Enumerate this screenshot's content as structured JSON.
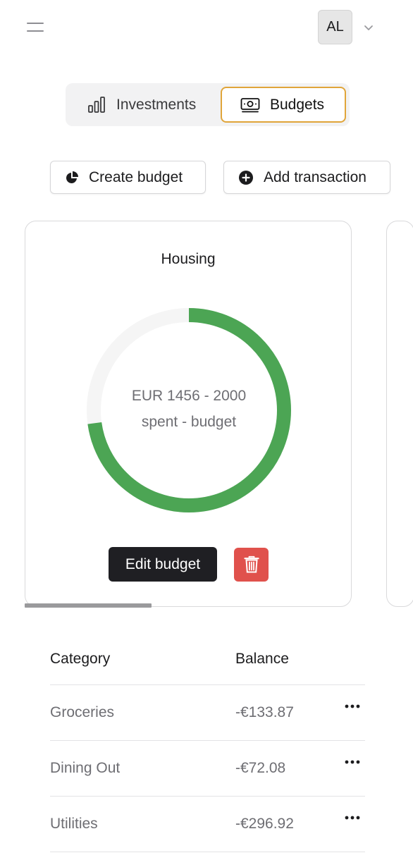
{
  "header": {
    "avatar_initials": "AL",
    "menu_icon": "hamburger-icon",
    "avatar_caret_icon": "chevron-down-icon"
  },
  "tabs": [
    {
      "label": "Investments",
      "icon": "bar-chart-icon",
      "selected": false
    },
    {
      "label": "Budgets",
      "icon": "cash-icon",
      "selected": true
    }
  ],
  "actions": {
    "create_budget": "Create budget",
    "add_transaction": "Add transaction"
  },
  "budget_card": {
    "title": "Housing",
    "line1": "EUR 1456 - 2000",
    "line2": "spent - budget",
    "spent": 1456,
    "budget": 2000,
    "edit_label": "Edit budget",
    "delete_icon": "trash-icon",
    "ring_color": "#4ca554",
    "ring_track_color": "#f5f5f5"
  },
  "carousel": {
    "scroll_fraction_visible": 0.39
  },
  "table": {
    "headers": {
      "category": "Category",
      "balance": "Balance"
    },
    "rows": [
      {
        "category": "Groceries",
        "balance": "-€133.87"
      },
      {
        "category": "Dining Out",
        "balance": "-€72.08"
      },
      {
        "category": "Utilities",
        "balance": "-€296.92"
      }
    ]
  },
  "colors": {
    "accent": "#e0a53a",
    "danger": "#e0514c",
    "primary_dark": "#1f1f23"
  }
}
